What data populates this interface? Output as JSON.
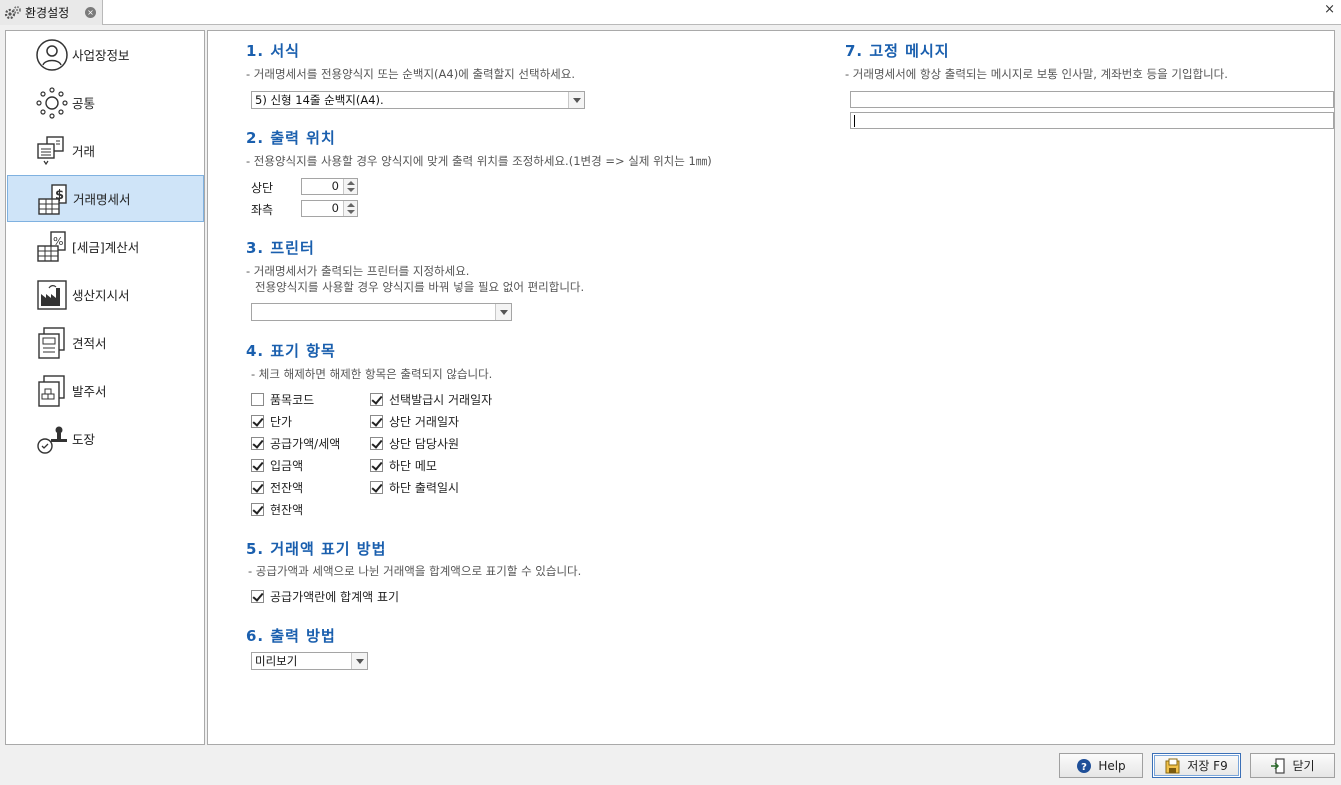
{
  "window": {
    "tab_title": "환경설정",
    "close_glyph": "×",
    "tab_close_glyph": "×"
  },
  "sidebar": {
    "items": [
      {
        "label": "사업장정보",
        "icon": "person-icon"
      },
      {
        "label": "공통",
        "icon": "sun-gear-icon"
      },
      {
        "label": "거래",
        "icon": "transaction-icon"
      },
      {
        "label": "거래명세서",
        "icon": "dollar-sheet-icon",
        "selected": true
      },
      {
        "label": "[세금]계산서",
        "icon": "percent-sheet-icon"
      },
      {
        "label": "생산지시서",
        "icon": "factory-icon"
      },
      {
        "label": "견적서",
        "icon": "clipboard-icon"
      },
      {
        "label": "발주서",
        "icon": "box-order-icon"
      },
      {
        "label": "도장",
        "icon": "stamp-icon"
      }
    ]
  },
  "sections": {
    "s1": {
      "title": "1. 서식",
      "desc": "- 거래명세서를 전용양식지 또는 순백지(A4)에 출력할지 선택하세요.",
      "select_value": "5) 신형 14줄 순백지(A4)."
    },
    "s2": {
      "title": "2. 출력 위치",
      "desc": "- 전용양식지를 사용할 경우 양식지에 맞게 출력 위치를 조정하세요.(1변경 => 실제 위치는 1㎜)",
      "top_label": "상단",
      "top_value": "0",
      "left_label": "좌측",
      "left_value": "0"
    },
    "s3": {
      "title": "3. 프린터",
      "desc1": "- 거래명세서가 출력되는 프린터를 지정하세요.",
      "desc2": "전용양식지를 사용할 경우 양식지를 바꿔 넣을 필요 없어 편리합니다.",
      "select_value": ""
    },
    "s4": {
      "title": "4. 표기 항목",
      "desc": "- 체크 해제하면 해제한 항목은 출력되지 않습니다.",
      "col1": [
        {
          "label": "품목코드",
          "checked": false
        },
        {
          "label": "단가",
          "checked": true
        },
        {
          "label": "공급가액/세액",
          "checked": true
        },
        {
          "label": "입금액",
          "checked": true
        },
        {
          "label": "전잔액",
          "checked": true
        },
        {
          "label": "현잔액",
          "checked": true
        }
      ],
      "col2": [
        {
          "label": "선택발급시 거래일자",
          "checked": true
        },
        {
          "label": "상단 거래일자",
          "checked": true
        },
        {
          "label": "상단 담당사원",
          "checked": true
        },
        {
          "label": "하단 메모",
          "checked": true
        },
        {
          "label": "하단 출력일시",
          "checked": true
        }
      ]
    },
    "s5": {
      "title": "5. 거래액 표기 방법",
      "desc": "- 공급가액과 세액으로 나뉜 거래액을 합계액으로 표기할 수 있습니다.",
      "checkbox_label": "공급가액란에 합계액 표기",
      "checked": true
    },
    "s6": {
      "title": "6. 출력 방법",
      "select_value": "미리보기"
    },
    "s7": {
      "title": "7. 고정 메시지",
      "desc": "- 거래명세서에 항상 출력되는 메시지로 보통 인사말, 계좌번호 등을 기입합니다.",
      "line1": "",
      "line2": ""
    }
  },
  "buttons": {
    "help": "Help",
    "save": "저장 F9",
    "close": "닫기"
  },
  "colors": {
    "section_title": "#1a5fae",
    "selected_bg": "#cfe4f8"
  }
}
